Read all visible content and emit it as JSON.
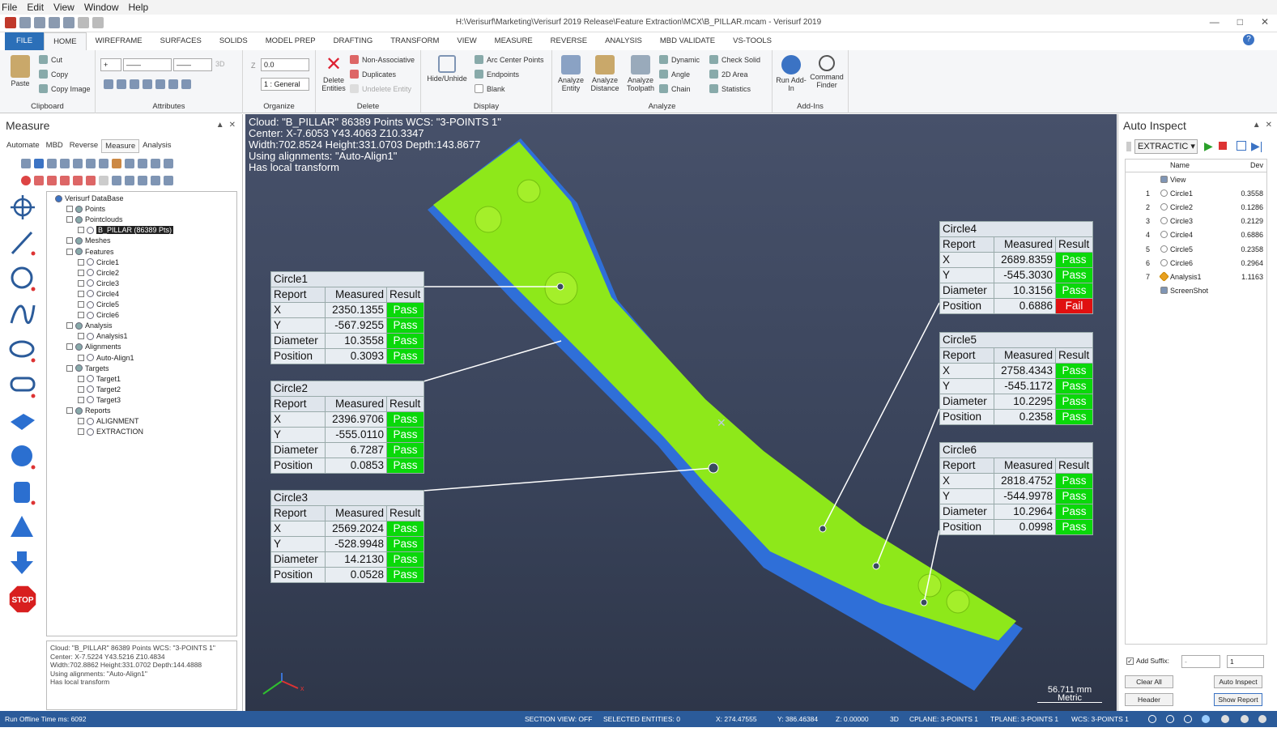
{
  "menu": [
    "File",
    "Edit",
    "View",
    "Window",
    "Help"
  ],
  "window_title": "H:\\Verisurf\\Marketing\\Verisurf 2019 Release\\Feature Extraction\\MCX\\B_PILLAR.mcam - Verisurf 2019",
  "ribbon_tabs": [
    "FILE",
    "HOME",
    "WIREFRAME",
    "SURFACES",
    "SOLIDS",
    "MODEL PREP",
    "DRAFTING",
    "TRANSFORM",
    "VIEW",
    "MEASURE",
    "REVERSE",
    "ANALYSIS",
    "MBD VALIDATE",
    "VS-TOOLS"
  ],
  "ribbon": {
    "clipboard": {
      "label": "Clipboard",
      "paste": "Paste",
      "cut": "Cut",
      "copy": "Copy",
      "copy_image": "Copy Image"
    },
    "attributes": {
      "label": "Attributes",
      "mode": "3D"
    },
    "organize": {
      "label": "Organize",
      "z_label": "Z",
      "z_value": "0.0",
      "level": "1 : General"
    },
    "delete": {
      "label": "Delete",
      "delete_entities": "Delete Entities",
      "non_associative": "Non-Associative",
      "duplicates": "Duplicates",
      "undelete": "Undelete Entity"
    },
    "display": {
      "label": "Display",
      "hide_unhide": "Hide/Unhide",
      "arc_center": "Arc Center Points",
      "endpoints": "Endpoints",
      "blank": "Blank"
    },
    "analyze": {
      "label": "Analyze",
      "entity": "Analyze Entity",
      "distance": "Analyze Distance",
      "toolpath": "Analyze Toolpath",
      "dynamic": "Dynamic",
      "angle": "Angle",
      "chain": "Chain",
      "check_solid": "Check Solid",
      "area_2d": "2D Area",
      "statistics": "Statistics"
    },
    "addins": {
      "label": "Add-Ins",
      "run": "Run Add-In",
      "finder": "Command Finder"
    }
  },
  "left_panel": {
    "title": "Measure",
    "tabs": [
      "Automate",
      "MBD",
      "Reverse",
      "Measure",
      "Analysis"
    ],
    "active_tab": "Measure",
    "tree": [
      {
        "label": "Verisurf DataBase",
        "level": 0
      },
      {
        "label": "Points",
        "level": 1
      },
      {
        "label": "Pointclouds",
        "level": 1
      },
      {
        "label": "B_PILLAR (86389 Pts)",
        "level": 2,
        "selected": true
      },
      {
        "label": "Meshes",
        "level": 1
      },
      {
        "label": "Features",
        "level": 1
      },
      {
        "label": "Circle1",
        "level": 2
      },
      {
        "label": "Circle2",
        "level": 2
      },
      {
        "label": "Circle3",
        "level": 2
      },
      {
        "label": "Circle4",
        "level": 2
      },
      {
        "label": "Circle5",
        "level": 2
      },
      {
        "label": "Circle6",
        "level": 2
      },
      {
        "label": "Analysis",
        "level": 1
      },
      {
        "label": "Analysis1",
        "level": 2
      },
      {
        "label": "Alignments",
        "level": 1
      },
      {
        "label": "Auto-Align1",
        "level": 2
      },
      {
        "label": "Targets",
        "level": 1
      },
      {
        "label": "Target1",
        "level": 2
      },
      {
        "label": "Target2",
        "level": 2
      },
      {
        "label": "Target3",
        "level": 2
      },
      {
        "label": "Reports",
        "level": 1
      },
      {
        "label": "ALIGNMENT",
        "level": 2
      },
      {
        "label": "EXTRACTION",
        "level": 2
      }
    ],
    "info": [
      "Cloud: \"B_PILLAR\" 86389 Points  WCS: \"3-POINTS 1\"",
      "Center: X-7.5224 Y43.5216 Z10.4834",
      "Width:702.8862 Height:331.0702 Depth:144.4888",
      "Using alignments: \"Auto-Align1\"",
      "Has local transform"
    ]
  },
  "viewport": {
    "info": [
      "Cloud: \"B_PILLAR\" 86389 Points  WCS: \"3-POINTS 1\"",
      "Center: X-7.6053 Y43.4063 Z10.3347",
      "Width:702.8524 Height:331.0703 Depth:143.8677",
      "Using alignments: \"Auto-Align1\"",
      "Has local transform"
    ],
    "col_headers": [
      "Report",
      "Measured",
      "Result"
    ],
    "tables": [
      {
        "name": "Circle1",
        "rows": [
          [
            "X",
            "2350.1355",
            "Pass"
          ],
          [
            "Y",
            "-567.9255",
            "Pass"
          ],
          [
            "Diameter",
            "10.3558",
            "Pass"
          ],
          [
            "Position",
            "0.3093",
            "Pass"
          ]
        ]
      },
      {
        "name": "Circle2",
        "rows": [
          [
            "X",
            "2396.9706",
            "Pass"
          ],
          [
            "Y",
            "-555.0110",
            "Pass"
          ],
          [
            "Diameter",
            "6.7287",
            "Pass"
          ],
          [
            "Position",
            "0.0853",
            "Pass"
          ]
        ]
      },
      {
        "name": "Circle3",
        "rows": [
          [
            "X",
            "2569.2024",
            "Pass"
          ],
          [
            "Y",
            "-528.9948",
            "Pass"
          ],
          [
            "Diameter",
            "14.2130",
            "Pass"
          ],
          [
            "Position",
            "0.0528",
            "Pass"
          ]
        ]
      },
      {
        "name": "Circle4",
        "rows": [
          [
            "X",
            "2689.8359",
            "Pass"
          ],
          [
            "Y",
            "-545.3030",
            "Pass"
          ],
          [
            "Diameter",
            "10.3156",
            "Pass"
          ],
          [
            "Position",
            "0.6886",
            "Fail"
          ]
        ]
      },
      {
        "name": "Circle5",
        "rows": [
          [
            "X",
            "2758.4343",
            "Pass"
          ],
          [
            "Y",
            "-545.1172",
            "Pass"
          ],
          [
            "Diameter",
            "10.2295",
            "Pass"
          ],
          [
            "Position",
            "0.2358",
            "Pass"
          ]
        ]
      },
      {
        "name": "Circle6",
        "rows": [
          [
            "X",
            "2818.4752",
            "Pass"
          ],
          [
            "Y",
            "-544.9978",
            "Pass"
          ],
          [
            "Diameter",
            "10.2964",
            "Pass"
          ],
          [
            "Position",
            "0.0998",
            "Pass"
          ]
        ]
      }
    ],
    "scale_value": "56.711 mm",
    "scale_unit": "Metric",
    "colors": {
      "pass": "#0ad80a",
      "fail": "#e01010",
      "part_green": "#8ee81a",
      "part_blue": "#2f6fd8"
    }
  },
  "right_panel": {
    "title": "Auto Inspect",
    "mode": "EXTRACTIC",
    "columns": [
      "Name",
      "Dev"
    ],
    "rows": [
      {
        "n": "",
        "name": "View",
        "dev": ""
      },
      {
        "n": "1",
        "name": "Circle1",
        "dev": "0.3558"
      },
      {
        "n": "2",
        "name": "Circle2",
        "dev": "0.1286"
      },
      {
        "n": "3",
        "name": "Circle3",
        "dev": "0.2129"
      },
      {
        "n": "4",
        "name": "Circle4",
        "dev": "0.6886"
      },
      {
        "n": "5",
        "name": "Circle5",
        "dev": "0.2358"
      },
      {
        "n": "6",
        "name": "Circle6",
        "dev": "0.2964"
      },
      {
        "n": "7",
        "name": "Analysis1",
        "dev": "1.1163"
      },
      {
        "n": "",
        "name": "ScreenShot",
        "dev": ""
      }
    ],
    "add_suffix": "Add Suffix:",
    "suffix_value": "-",
    "suffix_num": "1",
    "clear_all": "Clear All",
    "auto_inspect": "Auto Inspect",
    "header": "Header",
    "show_report": "Show Report"
  },
  "status": {
    "left": "Run Offline Time ms: 6092",
    "section": "SECTION VIEW: OFF",
    "selected": "SELECTED ENTITIES: 0",
    "x": "X:  274.47555",
    "y": "Y:  386.46384",
    "z": "Z:  0.00000",
    "mode": "3D",
    "cplane": "CPLANE: 3-POINTS 1",
    "tplane": "TPLANE: 3-POINTS 1",
    "wcs": "WCS: 3-POINTS 1"
  }
}
